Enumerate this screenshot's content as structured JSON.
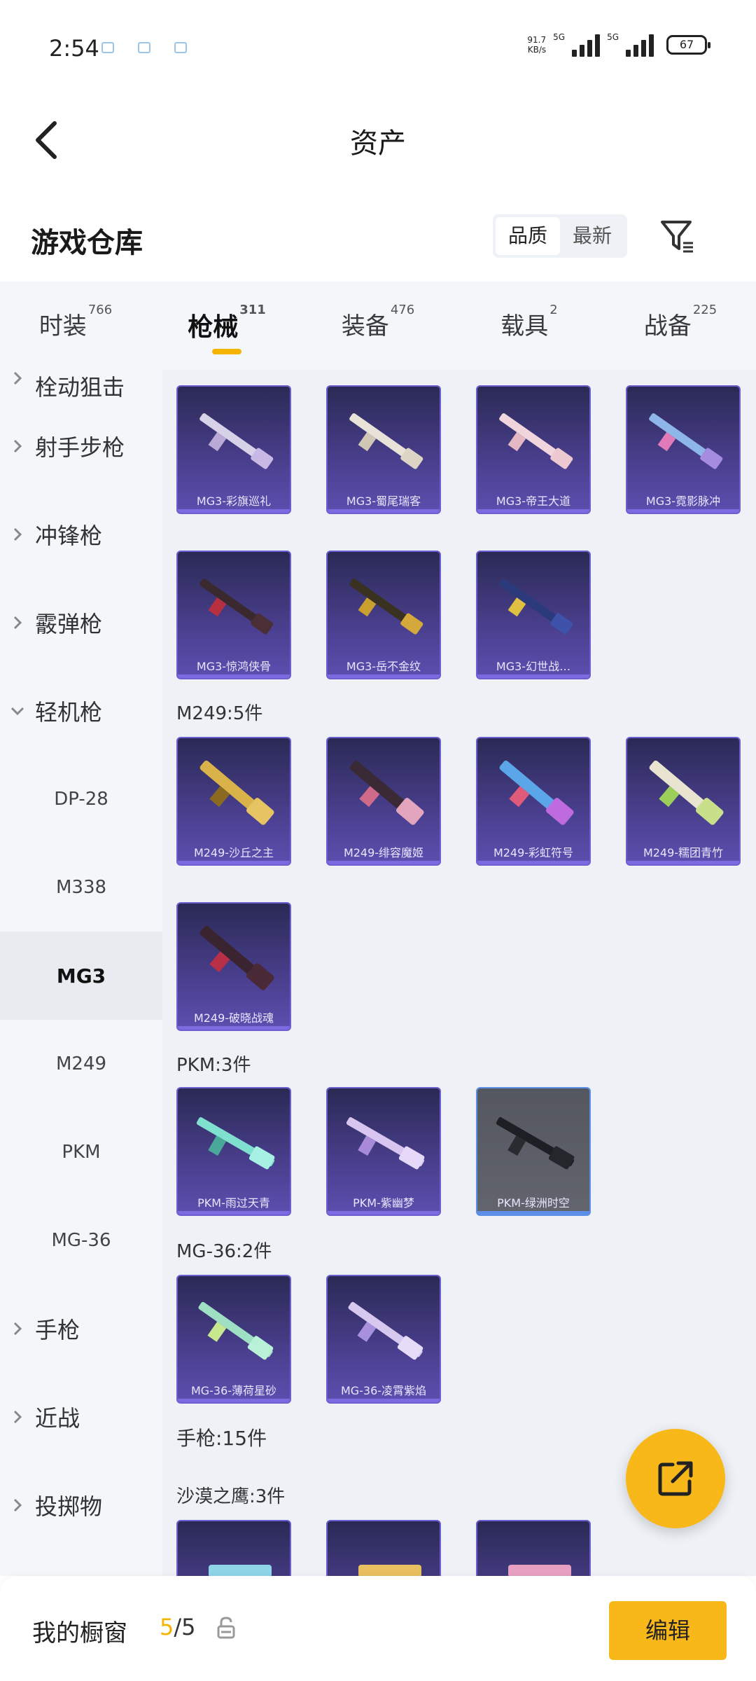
{
  "status": {
    "time": "2:54",
    "net_speed_value": "91.7",
    "net_speed_unit": "KB/s",
    "net_type_1": "5G",
    "net_type_2": "5G",
    "battery": "67"
  },
  "header": {
    "title": "资产"
  },
  "section": {
    "title": "游戏仓库",
    "sort_options": [
      "品质",
      "最新"
    ],
    "sort_active": "品质"
  },
  "tabs": [
    {
      "label": "时装",
      "count": "766"
    },
    {
      "label": "枪械",
      "count": "311"
    },
    {
      "label": "装备",
      "count": "476"
    },
    {
      "label": "载具",
      "count": "2"
    },
    {
      "label": "战备",
      "count": "225"
    }
  ],
  "sidebar": {
    "items": [
      {
        "label": "栓动狙击"
      },
      {
        "label": "射手步枪"
      },
      {
        "label": "冲锋枪"
      },
      {
        "label": "霰弹枪"
      },
      {
        "label": "轻机枪"
      },
      {
        "label": "DP-28"
      },
      {
        "label": "M338"
      },
      {
        "label": "MG3"
      },
      {
        "label": "M249"
      },
      {
        "label": "PKM"
      },
      {
        "label": "MG-36"
      },
      {
        "label": "手枪"
      },
      {
        "label": "近战"
      },
      {
        "label": "投掷物"
      }
    ]
  },
  "groups": {
    "m249": "M249:5件",
    "pkm": "PKM:3件",
    "mg36": "MG-36:2件",
    "pistol": "手枪:15件",
    "deagle": "沙漠之鹰:3件"
  },
  "cards": {
    "mg3": [
      "MG3-彩旗巡礼",
      "MG3-蜀尾瑞客",
      "MG3-帝王大道",
      "MG3-霓影脉冲",
      "MG3-惊鸿侠骨",
      "MG3-岳不金纹",
      "MG3-幻世战…"
    ],
    "m249": [
      "M249-沙丘之主",
      "M249-绯容魔姬",
      "M249-彩虹符号",
      "M249-糯团青竹",
      "M249-破晓战魂"
    ],
    "pkm": [
      "PKM-雨过天青",
      "PKM-紫幽梦",
      "PKM-绿洲时空"
    ],
    "mg36": [
      "MG-36-薄荷星砂",
      "MG-36-凌霄紫焰"
    ]
  },
  "bottom": {
    "label": "我的橱窗",
    "count_current": "5",
    "count_total": "/5",
    "edit_label": "编辑"
  },
  "colors": {
    "accent": "#f8b81a",
    "card_bg": "#4a3f8e",
    "card_border": "#6d5fcf",
    "sidebar_bg": "#f4f7fa",
    "content_bg": "#eef1f5"
  },
  "icons": [
    "back-arrow-icon",
    "filter-icon",
    "chevron-right-icon",
    "chevron-down-icon",
    "share-out-icon",
    "lock-icon"
  ]
}
